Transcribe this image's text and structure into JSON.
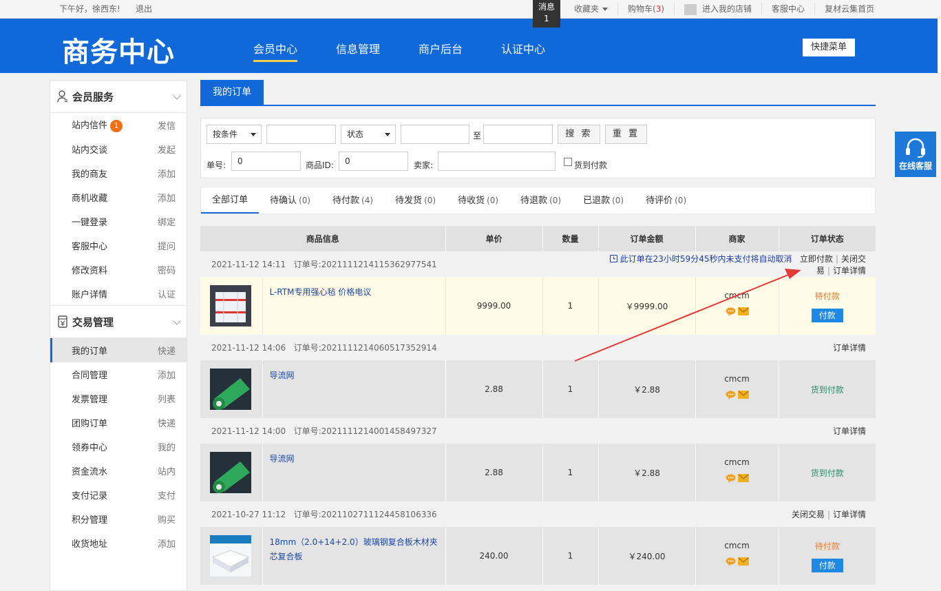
{
  "topbar": {
    "greeting": "下午好，徐西东!",
    "logout": "退出",
    "message_label": "消息",
    "message_count": "1",
    "favorites": "收藏夹",
    "cart_label": "购物车(",
    "cart_count": "3",
    "cart_close": ")",
    "store": "进入我的店铺",
    "service": "客服中心",
    "home": "复材云集首页"
  },
  "header": {
    "logo": "商务中心",
    "nav": [
      "会员中心",
      "信息管理",
      "商户后台",
      "认证中心"
    ],
    "quick_menu": "快捷菜单"
  },
  "sidebar": {
    "groups": [
      {
        "title": "会员服务",
        "icon": "user-icon",
        "items": [
          {
            "label": "站内信件",
            "badge": "1",
            "action": "发信"
          },
          {
            "label": "站内交谈",
            "action": "发起"
          },
          {
            "label": "我的商友",
            "action": "添加"
          },
          {
            "label": "商机收藏",
            "action": "添加"
          },
          {
            "label": "一键登录",
            "action": "绑定"
          },
          {
            "label": "客服中心",
            "action": "提问"
          },
          {
            "label": "修改资料",
            "action": "密码"
          },
          {
            "label": "账户详情",
            "action": "认证"
          }
        ]
      },
      {
        "title": "交易管理",
        "icon": "trade-icon",
        "items": [
          {
            "label": "我的订单",
            "action": "快递"
          },
          {
            "label": "合同管理",
            "action": "添加"
          },
          {
            "label": "发票管理",
            "action": "列表"
          },
          {
            "label": "团购订单",
            "action": "快递"
          },
          {
            "label": "领券中心",
            "action": "我的"
          },
          {
            "label": "资金流水",
            "action": "站内"
          },
          {
            "label": "支付记录",
            "action": "支付"
          },
          {
            "label": "积分管理",
            "action": "购买"
          },
          {
            "label": "收货地址",
            "action": "添加"
          }
        ]
      }
    ]
  },
  "main": {
    "tab_title": "我的订单",
    "filter": {
      "condition_select": "按条件",
      "status_select": "状态",
      "to_label": "至",
      "search_btn": "搜 索",
      "reset_btn": "重 置",
      "order_no_label": "单号:",
      "order_no_value": "0",
      "product_id_label": "商品ID:",
      "product_id_value": "0",
      "seller_label": "卖家:",
      "cod_label": "货到付款"
    },
    "order_tabs": [
      {
        "label": "全部订单",
        "count": ""
      },
      {
        "label": "待确认",
        "count": "(0)"
      },
      {
        "label": "待付款",
        "count": "(4)"
      },
      {
        "label": "待发货",
        "count": "(0)"
      },
      {
        "label": "待收货",
        "count": "(0)"
      },
      {
        "label": "待退款",
        "count": "(0)"
      },
      {
        "label": "已退款",
        "count": "(0)"
      },
      {
        "label": "待评价",
        "count": "(0)"
      }
    ],
    "columns": [
      "商品信息",
      "单价",
      "数量",
      "订单金额",
      "商家",
      "订单状态"
    ],
    "orders": [
      {
        "date": "2021-11-12 14:11",
        "order_no_label": "订单号:",
        "order_no": "2021111214115362977541",
        "timer": "此订单在23小时59分45秒内未支付将自动取消",
        "actions": [
          "立即付款",
          "关闭交易",
          "订单详情"
        ],
        "product": "L-RTM专用强心毡 价格电议",
        "price": "9999.00",
        "qty": "1",
        "amount": "￥9999.00",
        "seller": "cmcm",
        "status": "待付款",
        "pay_btn": "付款"
      },
      {
        "date": "2021-11-12 14:06",
        "order_no_label": "订单号:",
        "order_no": "2021111214060517352914",
        "actions": [
          "订单详情"
        ],
        "product": "导流网",
        "price": "2.88",
        "qty": "1",
        "amount": "￥2.88",
        "seller": "cmcm",
        "status": "货到付款"
      },
      {
        "date": "2021-11-12 14:00",
        "order_no_label": "订单号:",
        "order_no": "2021111214001458497327",
        "actions": [
          "订单详情"
        ],
        "product": "导流网",
        "price": "2.88",
        "qty": "1",
        "amount": "￥2.88",
        "seller": "cmcm",
        "status": "货到付款"
      },
      {
        "date": "2021-10-27 11:12",
        "order_no_label": "订单号:",
        "order_no": "2021102711124458106336",
        "actions": [
          "关闭交易",
          "订单详情"
        ],
        "product": "18mm（2.0+14+2.0）玻璃钢复合板木材夹芯复合板",
        "price": "240.00",
        "qty": "1",
        "amount": "￥240.00",
        "seller": "cmcm",
        "status": "待付款",
        "pay_btn": "付款"
      }
    ]
  },
  "service_float": "在线客服",
  "colors": {
    "brand": "#1168d8",
    "accent": "#f3d04a",
    "annotation": "#e53935"
  }
}
